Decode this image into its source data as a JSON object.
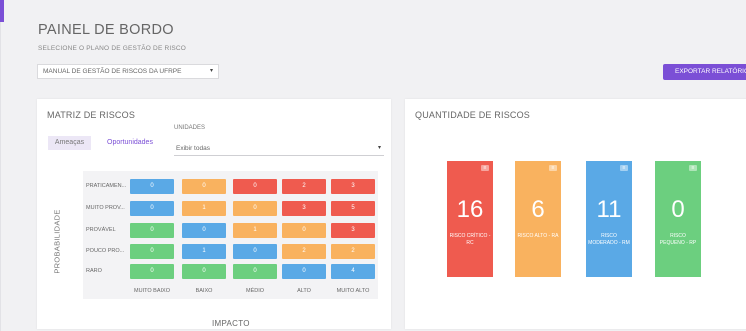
{
  "page": {
    "title": "PAINEL DE BORDO",
    "plan_label": "SELECIONE O PLANO DE GESTÃO DE RISCO",
    "plan_selected": "MANUAL DE GESTÃO DE RISCOS DA UFRPE",
    "export_label": "EXPORTAR RELATÓRIO"
  },
  "matrix": {
    "title": "MATRIZ DE RISCOS",
    "tabs": [
      "Ameaças",
      "Oportunidades"
    ],
    "units_label": "UNIDADES",
    "units_selected": "Exibir todas",
    "y_axis_label": "PROBABILIDADE",
    "x_axis_label": "IMPACTO",
    "rows": [
      "PRATICAMEN...",
      "MUITO PROV...",
      "PROVÁVEL",
      "POUCO PRO...",
      "RARO"
    ],
    "cols": [
      "MUITO BAIXO",
      "BAIXO",
      "MÉDIO",
      "ALTO",
      "MUITO ALTO"
    ],
    "values": [
      [
        0,
        0,
        0,
        2,
        3
      ],
      [
        0,
        1,
        0,
        3,
        5
      ],
      [
        0,
        0,
        1,
        0,
        3
      ],
      [
        0,
        1,
        0,
        2,
        2
      ],
      [
        0,
        0,
        0,
        0,
        4
      ]
    ],
    "colors": [
      [
        "#5aa9e6",
        "#f9b25f",
        "#ef5b4f",
        "#ef5b4f",
        "#ef5b4f"
      ],
      [
        "#5aa9e6",
        "#f9b25f",
        "#f9b25f",
        "#ef5b4f",
        "#ef5b4f"
      ],
      [
        "#6ccf7f",
        "#5aa9e6",
        "#f9b25f",
        "#f9b25f",
        "#ef5b4f"
      ],
      [
        "#6ccf7f",
        "#5aa9e6",
        "#5aa9e6",
        "#f9b25f",
        "#f9b25f"
      ],
      [
        "#6ccf7f",
        "#6ccf7f",
        "#6ccf7f",
        "#5aa9e6",
        "#5aa9e6"
      ]
    ]
  },
  "quantity": {
    "title": "QUANTIDADE DE RISCOS",
    "tiles": [
      {
        "count": "16",
        "label": "RISCO CRÍTICO - RC",
        "color": "#ef5b4f"
      },
      {
        "count": "6",
        "label": "RISCO ALTO - RA",
        "color": "#f9b25f"
      },
      {
        "count": "11",
        "label": "RISCO MODERADO - RM",
        "color": "#5aa9e6"
      },
      {
        "count": "0",
        "label": "RISCO PEQUENO - RP",
        "color": "#6ccf7f"
      }
    ]
  },
  "icons": {
    "caret": "▾",
    "tile_icon": "≡"
  }
}
